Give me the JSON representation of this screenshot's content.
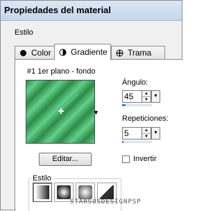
{
  "window": {
    "title": "Propiedades del material"
  },
  "section": {
    "label": "Estilo"
  },
  "tabs": [
    {
      "label": "Color",
      "icon": "color-dot-icon"
    },
    {
      "label": "Gradiente",
      "icon": "gradient-icon"
    },
    {
      "label": "Trama",
      "icon": "pattern-icon"
    }
  ],
  "active_tab": "Gradiente",
  "gradient": {
    "name": "#1 1er plano - fondo",
    "colors": [
      "#2f8a48",
      "#5fd08a"
    ]
  },
  "angle": {
    "label": "Ángulo:",
    "value": "45",
    "fill": 0.125
  },
  "repetitions": {
    "label": "Repeticiones:",
    "value": "5",
    "fill": 0.05
  },
  "edit_button": {
    "label": "Editar..."
  },
  "invert": {
    "label": "Invertir",
    "checked": false
  },
  "style_group": {
    "label": "Estilo",
    "options": [
      "linear",
      "rectangular",
      "radial",
      "sunburst"
    ],
    "selected": "linear"
  },
  "watermark": {
    "text": "STARSUSDESIGNPSP"
  }
}
